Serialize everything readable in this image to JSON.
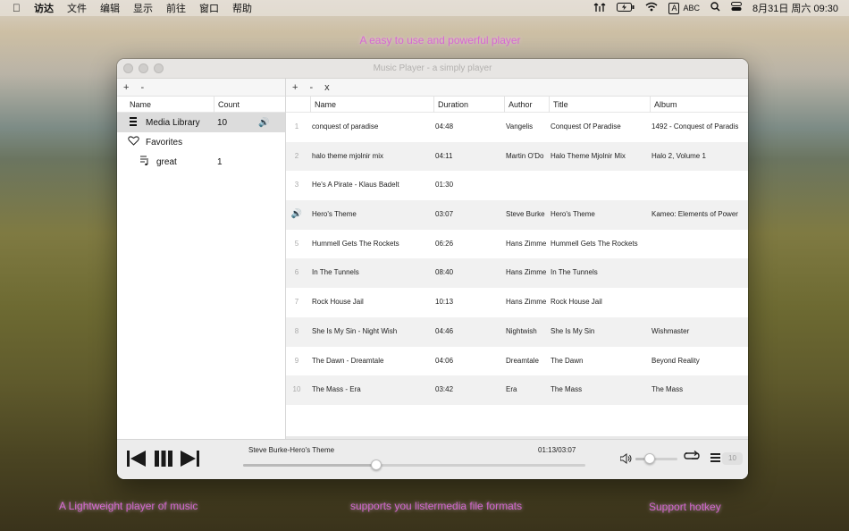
{
  "menubar": {
    "apple": "",
    "items": [
      "访达",
      "文件",
      "编辑",
      "显示",
      "前往",
      "窗口",
      "帮助"
    ],
    "input_method": "A",
    "input_method_label": "ABC",
    "clock": "8月31日 周六  09:30"
  },
  "promo": {
    "top": "A easy to use and powerful player",
    "bottom_left": "A Lightweight player of music",
    "bottom_center": "supports you listermedia file formats",
    "bottom_right": "Support hotkey"
  },
  "window": {
    "title": "Music Player - a simply player"
  },
  "left_pane": {
    "toolbar": {
      "add": "+",
      "remove": "-"
    },
    "columns": {
      "name": "Name",
      "count": "Count"
    },
    "items": [
      {
        "icon": "list-icon",
        "label": "Media Library",
        "count": "10",
        "playing": true
      },
      {
        "icon": "heart-icon",
        "label": "Favorites",
        "count": ""
      },
      {
        "icon": "playlist-icon",
        "label": "great",
        "count": "1"
      }
    ]
  },
  "right_pane": {
    "toolbar": {
      "add": "+",
      "remove": "-",
      "clear": "x"
    },
    "columns": {
      "name": "Name",
      "duration": "Duration",
      "author": "Author",
      "title": "Title",
      "album": "Album"
    },
    "tracks": [
      {
        "no": "1",
        "name": "conquest of paradise",
        "duration": "04:48",
        "author": "Vangelis",
        "title": "Conquest Of Paradise",
        "album": "1492 - Conquest of Paradis"
      },
      {
        "no": "2",
        "name": "halo theme mjolnir mix",
        "duration": "04:11",
        "author": "Martin O'Do",
        "title": "Halo Theme Mjolnir Mix",
        "album": "Halo 2, Volume 1"
      },
      {
        "no": "3",
        "name": "He's A Pirate - Klaus Badelt",
        "duration": "01:30",
        "author": "",
        "title": "",
        "album": ""
      },
      {
        "no": "",
        "name": "Hero's Theme",
        "duration": "03:07",
        "author": "Steve Burke",
        "title": "Hero's Theme",
        "album": "Kameo: Elements of Power",
        "playing": true
      },
      {
        "no": "5",
        "name": "Hummell Gets The Rockets",
        "duration": "06:26",
        "author": "Hans Zimme",
        "title": "Hummell Gets The Rockets",
        "album": ""
      },
      {
        "no": "6",
        "name": "In The Tunnels",
        "duration": "08:40",
        "author": "Hans Zimme",
        "title": "In The Tunnels",
        "album": ""
      },
      {
        "no": "7",
        "name": "Rock House Jail",
        "duration": "10:13",
        "author": "Hans Zimme",
        "title": "Rock House Jail",
        "album": ""
      },
      {
        "no": "8",
        "name": "She Is My Sin - Night Wish",
        "duration": "04:46",
        "author": "Nightwish",
        "title": "She Is My Sin",
        "album": "Wishmaster"
      },
      {
        "no": "9",
        "name": "The Dawn - Dreamtale",
        "duration": "04:06",
        "author": "Dreamtale",
        "title": "The Dawn",
        "album": "Beyond Reality"
      },
      {
        "no": "10",
        "name": "The Mass - Era",
        "duration": "03:42",
        "author": "Era",
        "title": "The Mass",
        "album": "The Mass"
      }
    ]
  },
  "player": {
    "now_playing": "Steve Burke-Hero's Theme",
    "time": "01:13/03:07",
    "progress_fraction": 0.39,
    "volume_fraction": 0.35,
    "playlist_count": "10"
  }
}
